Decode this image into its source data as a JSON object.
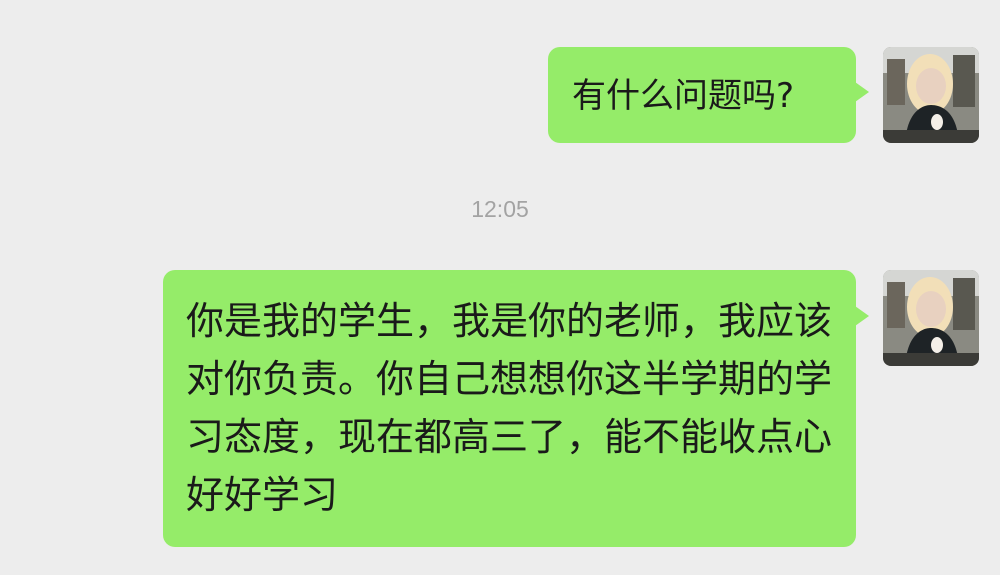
{
  "messages": [
    {
      "text": "有什么问题吗?"
    },
    {
      "text": "你是我的学生，我是你的老师，我应该对你负责。你自己想想你这半学期的学习态度，现在都高三了，能不能收点心好好学习"
    }
  ],
  "time_separator": "12:05",
  "colors": {
    "background": "#ededed",
    "bubble": "#95ec69",
    "text": "#1a1a1a",
    "time": "#a3a3a3"
  },
  "icons": {
    "avatar": "user-avatar-photo"
  }
}
